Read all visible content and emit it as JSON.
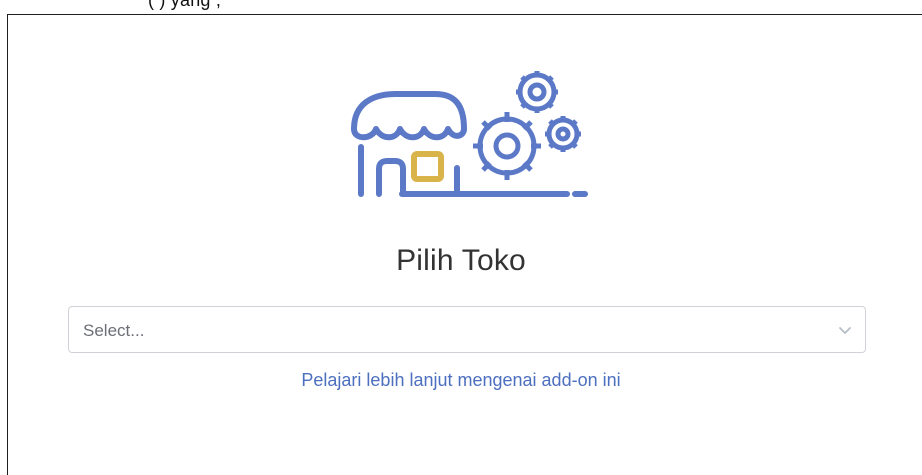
{
  "header": {
    "clipped_text": "(                              ) yang                                                                ,"
  },
  "page": {
    "title": "Pilih Toko"
  },
  "select": {
    "placeholder": "Select..."
  },
  "link": {
    "text": "Pelajari lebih lanjut mengenai add-on ini"
  },
  "icons": {
    "store": "store-icon",
    "gears": "gears-icon",
    "chevron": "chevron-down-icon"
  },
  "colors": {
    "illustration_blue": "#5b79c7",
    "illustration_gold": "#d8b44a",
    "link": "#4d6fbf",
    "title": "#333333",
    "border": "#cfd3d8"
  }
}
